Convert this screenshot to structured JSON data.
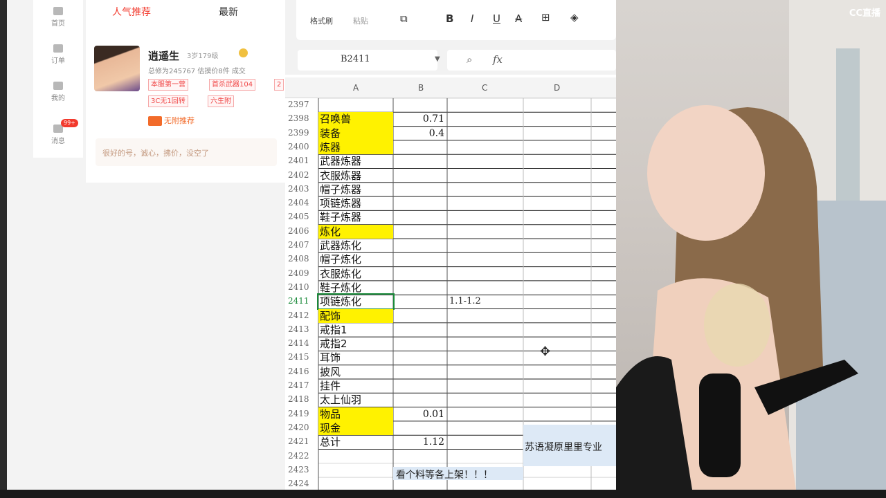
{
  "left_app": {
    "side_nav": [
      {
        "label": "首页",
        "icon": "home-icon"
      },
      {
        "label": "订单",
        "icon": "orders-icon"
      },
      {
        "label": "我的",
        "icon": "user-icon"
      },
      {
        "label": "消息",
        "icon": "message-icon",
        "badge": "99+"
      }
    ],
    "tabs": [
      {
        "label": "人气推荐",
        "active": true
      },
      {
        "label": "最新",
        "active": false
      }
    ],
    "seller": {
      "name": "逍遥生",
      "sub": "3岁179级",
      "stats": "总修为245767  估摸价8件  成交",
      "tags": [
        "本服第一营",
        "首杀武器104",
        "2",
        "3C无1回转",
        "六生附"
      ],
      "promo": "无附推荐",
      "quote": "很好的号，诚心，拂价，没空了"
    },
    "accent": "#f23a2d"
  },
  "spreadsheet": {
    "toolbar": {
      "format_painter": "格式刷",
      "paste": "粘贴",
      "bold": "B",
      "italic": "I",
      "underline": "U",
      "strike": "A"
    },
    "name_box": "B2411",
    "fx": "fx",
    "columns": [
      "A",
      "B",
      "C",
      "D"
    ],
    "rows": [
      {
        "n": "2397",
        "a": "",
        "b": "",
        "c": "",
        "hl": false
      },
      {
        "n": "2398",
        "a": "召唤兽",
        "b": "0.71",
        "c": "",
        "hl": true
      },
      {
        "n": "2399",
        "a": "装备",
        "b": "0.4",
        "c": "",
        "hl": true
      },
      {
        "n": "2400",
        "a": "炼器",
        "b": "",
        "c": "",
        "hl": true
      },
      {
        "n": "2401",
        "a": "武器炼器",
        "b": "",
        "c": "",
        "hl": false
      },
      {
        "n": "2402",
        "a": "衣服炼器",
        "b": "",
        "c": "",
        "hl": false
      },
      {
        "n": "2403",
        "a": "帽子炼器",
        "b": "",
        "c": "",
        "hl": false
      },
      {
        "n": "2404",
        "a": "项链炼器",
        "b": "",
        "c": "",
        "hl": false
      },
      {
        "n": "2405",
        "a": "鞋子炼器",
        "b": "",
        "c": "",
        "hl": false
      },
      {
        "n": "2406",
        "a": "炼化",
        "b": "",
        "c": "",
        "hl": true
      },
      {
        "n": "2407",
        "a": "武器炼化",
        "b": "",
        "c": "",
        "hl": false
      },
      {
        "n": "2408",
        "a": "帽子炼化",
        "b": "",
        "c": "",
        "hl": false
      },
      {
        "n": "2409",
        "a": "衣服炼化",
        "b": "",
        "c": "",
        "hl": false
      },
      {
        "n": "2410",
        "a": "鞋子炼化",
        "b": "",
        "c": "",
        "hl": false
      },
      {
        "n": "2411",
        "a": "项链炼化",
        "b": "",
        "c": "1.1-1.2",
        "hl": false
      },
      {
        "n": "2412",
        "a": "配饰",
        "b": "",
        "c": "",
        "hl": true
      },
      {
        "n": "2413",
        "a": "戒指1",
        "b": "",
        "c": "",
        "hl": false
      },
      {
        "n": "2414",
        "a": "戒指2",
        "b": "",
        "c": "",
        "hl": false
      },
      {
        "n": "2415",
        "a": "耳饰",
        "b": "",
        "c": "",
        "hl": false
      },
      {
        "n": "2416",
        "a": "披风",
        "b": "",
        "c": "",
        "hl": false
      },
      {
        "n": "2417",
        "a": "挂件",
        "b": "",
        "c": "",
        "hl": false
      },
      {
        "n": "2418",
        "a": "太上仙羽",
        "b": "",
        "c": "",
        "hl": false
      },
      {
        "n": "2419",
        "a": "物品",
        "b": "0.01",
        "c": "",
        "hl": true
      },
      {
        "n": "2420",
        "a": "现金",
        "b": "",
        "c": "",
        "hl": true
      },
      {
        "n": "2421",
        "a": "总计",
        "b": "1.12",
        "c": "",
        "hl": false
      },
      {
        "n": "2422",
        "a": "",
        "b": "",
        "c": "",
        "hl": false
      },
      {
        "n": "2423",
        "a": "",
        "b": "",
        "c": "",
        "hl": false
      },
      {
        "n": "2424",
        "a": "",
        "b": "",
        "c": "",
        "hl": false
      }
    ],
    "note_d": "苏语凝原里里专业",
    "note_b": "看个料等各上架！！！",
    "highlight_color": "#fff200",
    "note_color": "#dde9f6"
  },
  "stream": {
    "logo": "CC直播"
  }
}
